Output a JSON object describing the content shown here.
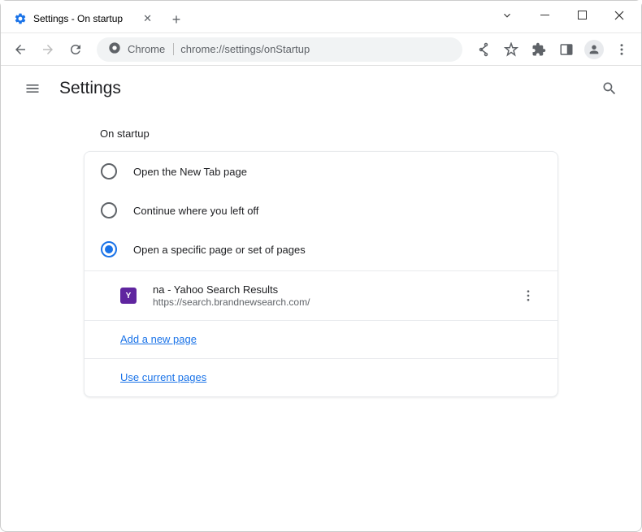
{
  "titlebar": {
    "tab_title": "Settings - On startup"
  },
  "omnibox": {
    "chrome_label": "Chrome",
    "url": "chrome://settings/onStartup"
  },
  "header": {
    "title": "Settings"
  },
  "startup": {
    "section_title": "On startup",
    "options": [
      {
        "label": "Open the New Tab page"
      },
      {
        "label": "Continue where you left off"
      },
      {
        "label": "Open a specific page or set of pages"
      }
    ],
    "pages": [
      {
        "title": "na - Yahoo Search Results",
        "url": "https://search.brandnewsearch.com/",
        "favicon_letter": "Y"
      }
    ],
    "add_page_label": "Add a new page",
    "use_current_label": "Use current pages"
  }
}
